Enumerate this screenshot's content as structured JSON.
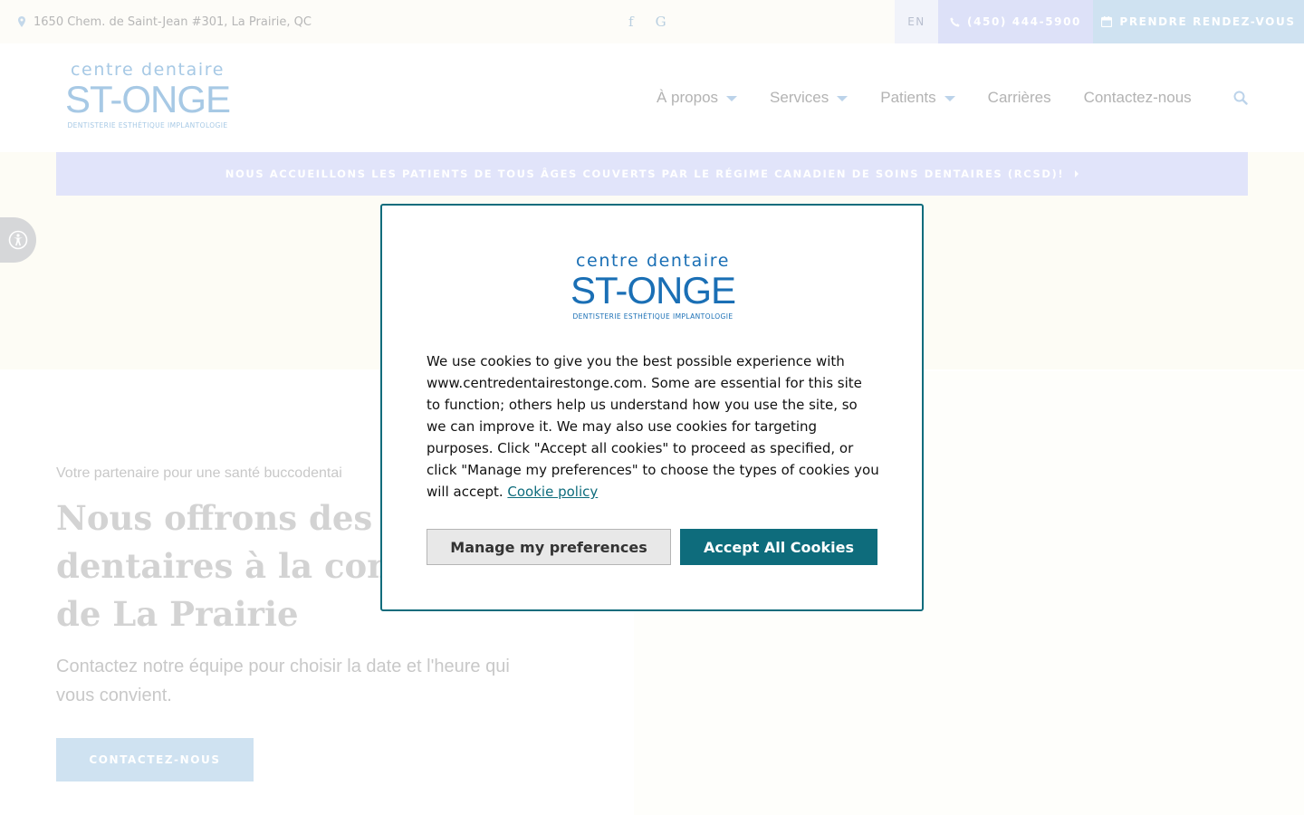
{
  "topbar": {
    "address": "1650 Chem. de Saint-Jean #301, La Prairie, QC",
    "social": {
      "facebook_glyph": "f",
      "google_glyph": "G"
    },
    "lang": "EN",
    "phone": "(450) 444-5900",
    "book": "PRENDRE RENDEZ-VOUS"
  },
  "logo": {
    "line1": "centre dentaire",
    "line2": "ST-ONGE",
    "line3": "DENTISTERIE ESTHÉTIQUE IMPLANTOLOGIE"
  },
  "nav": {
    "items": [
      {
        "label": "À propos",
        "has_dropdown": true
      },
      {
        "label": "Services",
        "has_dropdown": true
      },
      {
        "label": "Patients",
        "has_dropdown": true
      },
      {
        "label": "Carrières",
        "has_dropdown": false
      },
      {
        "label": "Contactez-nous",
        "has_dropdown": false
      }
    ],
    "search_icon": "search-icon"
  },
  "announcement": "NOUS ACCUEILLONS LES PATIENTS DE TOUS ÂGES COUVERTS PAR LE RÉGIME CANADIEN DE SOINS DENTAIRES (RCSD)!",
  "hero": {
    "kicker": "Votre partenaire pour une santé buccodentai",
    "title_lines": [
      "Nous offrons des se",
      "dentaires à la comm",
      "de La Prairie"
    ],
    "subtitle": "Contactez notre équipe pour choisir la date et l'heure qui vous convient.",
    "button": "CONTACTEZ-NOUS"
  },
  "cookie": {
    "text": "We use cookies to give you the best possible experience with www.centredentairestonge.com. Some are essential for this site to function; others help us understand how you use the site, so we can improve it. We may also use cookies for targeting purposes. Click \"Accept all cookies\" to proceed as specified, or click \"Manage my preferences\" to choose the types of cookies you will accept.",
    "policy_link": "Cookie policy",
    "manage_button": "Manage my preferences",
    "accept_button": "Accept All Cookies"
  },
  "colors": {
    "modal_accent": "#0e6c7c",
    "logo_blue": "#1a6fb5",
    "pale_blue": "#cfe2f1",
    "pale_lavender": "#e1e4fa"
  }
}
